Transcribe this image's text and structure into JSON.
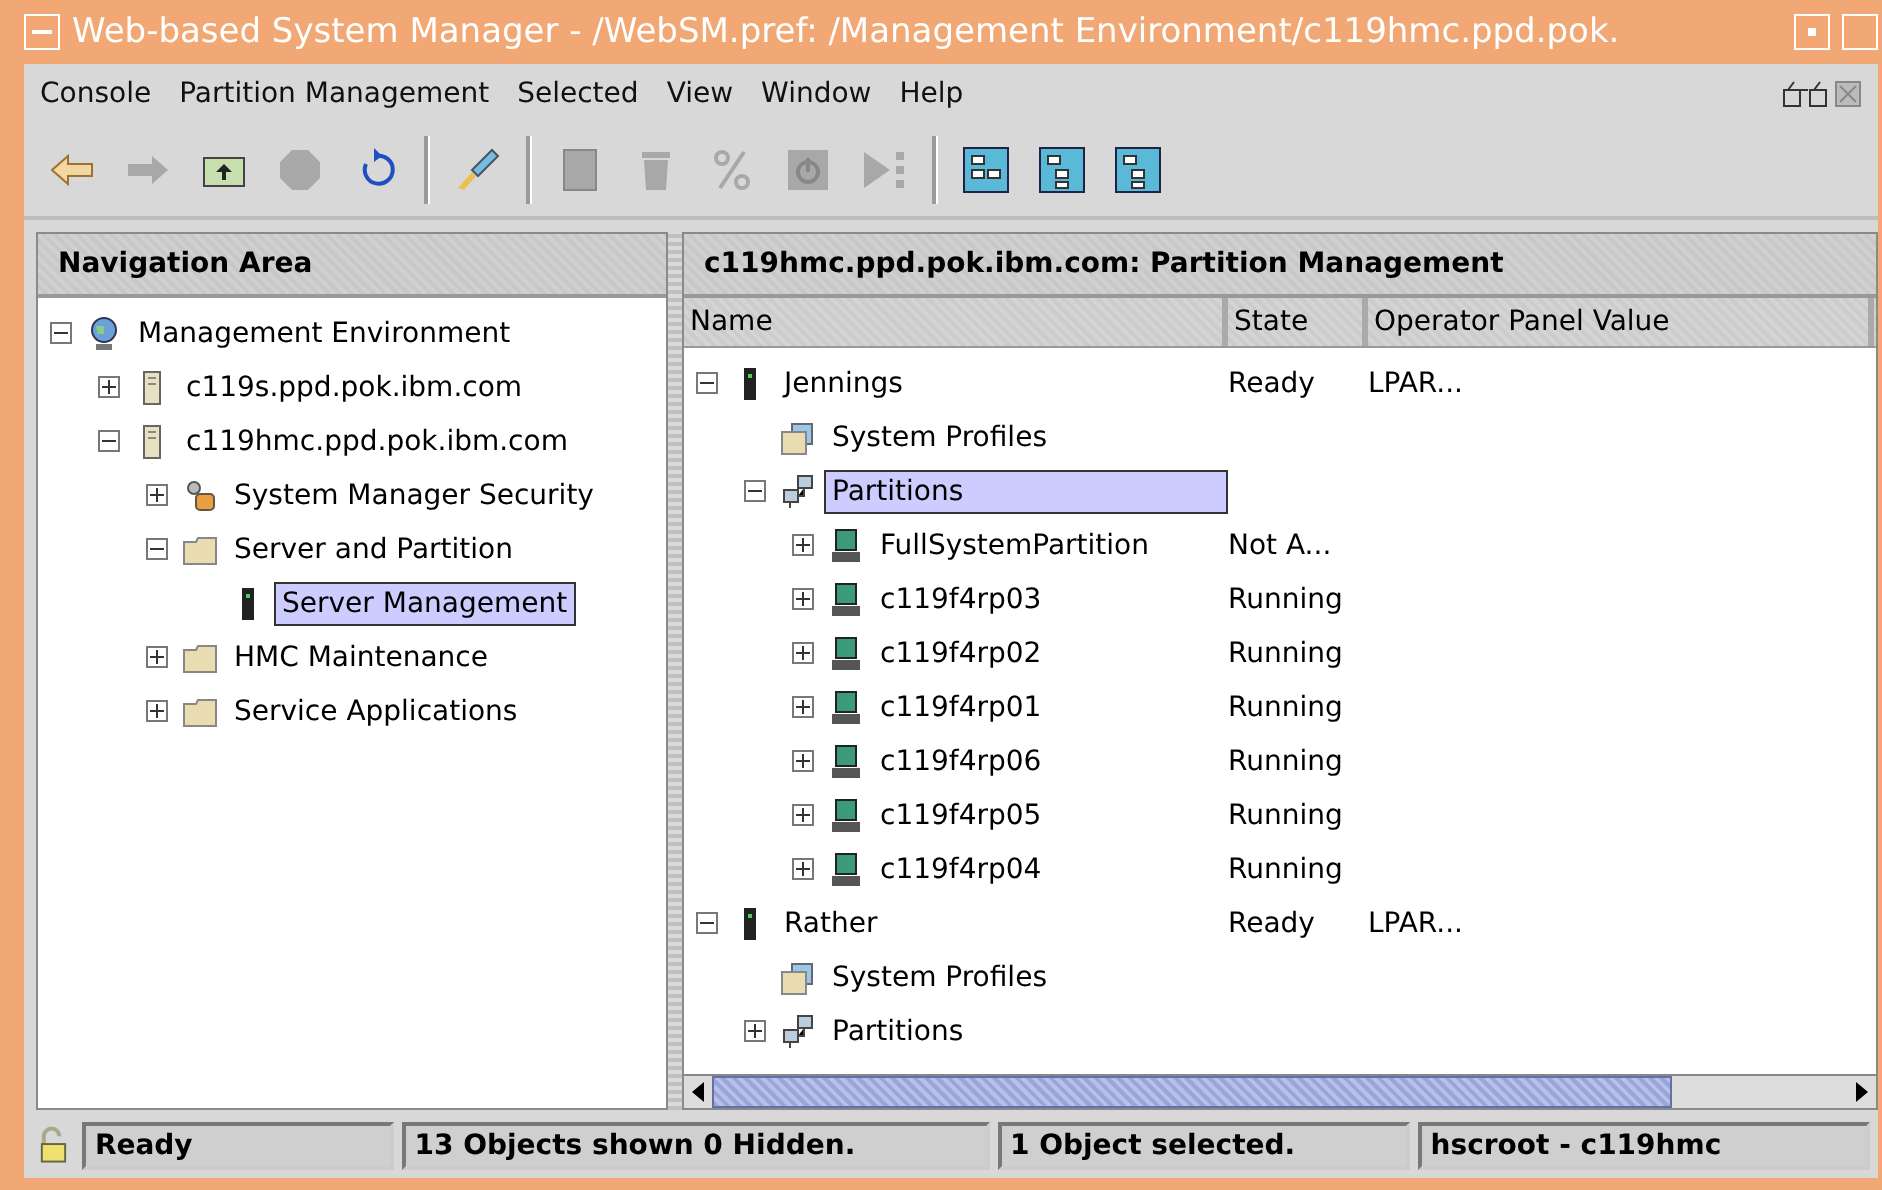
{
  "window": {
    "title": "Web-based System Manager - /WebSM.pref: /Management Environment/c119hmc.ppd.pok."
  },
  "menu": [
    "Console",
    "Partition Management",
    "Selected",
    "View",
    "Window",
    "Help"
  ],
  "toolbar": [
    {
      "kind": "back",
      "disabled": false
    },
    {
      "kind": "forward",
      "disabled": true
    },
    {
      "kind": "folder-up",
      "disabled": false
    },
    {
      "kind": "stop",
      "disabled": true
    },
    {
      "kind": "refresh",
      "disabled": false
    },
    {
      "kind": "separator"
    },
    {
      "kind": "brush",
      "disabled": false
    },
    {
      "kind": "separator"
    },
    {
      "kind": "document",
      "disabled": true
    },
    {
      "kind": "trash",
      "disabled": true
    },
    {
      "kind": "percent",
      "disabled": true
    },
    {
      "kind": "power",
      "disabled": true
    },
    {
      "kind": "play",
      "disabled": true
    },
    {
      "kind": "separator"
    },
    {
      "kind": "view-list",
      "disabled": false
    },
    {
      "kind": "view-tree",
      "disabled": false
    },
    {
      "kind": "view-details",
      "disabled": false
    }
  ],
  "navigation": {
    "title": "Navigation Area",
    "tree": [
      {
        "label": "Management Environment",
        "kind": "globe",
        "expanded": true,
        "selected": false,
        "children": [
          {
            "label": "c119s.ppd.pok.ibm.com",
            "kind": "host",
            "expanded": false,
            "selected": false
          },
          {
            "label": "c119hmc.ppd.pok.ibm.com",
            "kind": "host",
            "expanded": true,
            "selected": false,
            "children": [
              {
                "label": "System Manager Security",
                "kind": "security",
                "expanded": false,
                "selected": false
              },
              {
                "label": "Server and Partition",
                "kind": "folder",
                "expanded": true,
                "selected": false,
                "children": [
                  {
                    "label": "Server Management",
                    "kind": "server",
                    "selected": true
                  }
                ]
              },
              {
                "label": "HMC Maintenance",
                "kind": "folder",
                "expanded": false,
                "selected": false
              },
              {
                "label": "Service Applications",
                "kind": "folder",
                "expanded": false,
                "selected": false
              }
            ]
          }
        ]
      }
    ]
  },
  "content": {
    "title": "c119hmc.ppd.pok.ibm.com: Partition Management",
    "columns": [
      "Name",
      "State",
      "Operator Panel Value"
    ],
    "rows": [
      {
        "name": "Jennings",
        "kind": "server",
        "state": "Ready",
        "panel_value": "LPAR...",
        "expanded": true,
        "selected": false,
        "children": [
          {
            "name": "System Profiles",
            "kind": "profiles",
            "selected": false
          },
          {
            "name": "Partitions",
            "kind": "partitions",
            "expanded": true,
            "selected": true,
            "children": [
              {
                "name": "FullSystemPartition",
                "kind": "partition",
                "state": "Not A...",
                "expanded": false,
                "selected": false
              },
              {
                "name": "c119f4rp03",
                "kind": "partition",
                "state": "Running",
                "expanded": false,
                "selected": false
              },
              {
                "name": "c119f4rp02",
                "kind": "partition",
                "state": "Running",
                "expanded": false,
                "selected": false
              },
              {
                "name": "c119f4rp01",
                "kind": "partition",
                "state": "Running",
                "expanded": false,
                "selected": false
              },
              {
                "name": "c119f4rp06",
                "kind": "partition",
                "state": "Running",
                "expanded": false,
                "selected": false
              },
              {
                "name": "c119f4rp05",
                "kind": "partition",
                "state": "Running",
                "expanded": false,
                "selected": false
              },
              {
                "name": "c119f4rp04",
                "kind": "partition",
                "state": "Running",
                "expanded": false,
                "selected": false
              }
            ]
          }
        ]
      },
      {
        "name": "Rather",
        "kind": "server",
        "state": "Ready",
        "panel_value": "LPAR...",
        "expanded": true,
        "selected": false,
        "children": [
          {
            "name": "System Profiles",
            "kind": "profiles",
            "selected": false
          },
          {
            "name": "Partitions",
            "kind": "partitions",
            "expanded": false,
            "selected": false
          }
        ]
      }
    ]
  },
  "status_bar": [
    "Ready",
    "13 Objects shown 0 Hidden.",
    "1 Object selected.",
    "hscroot - c119hmc"
  ]
}
